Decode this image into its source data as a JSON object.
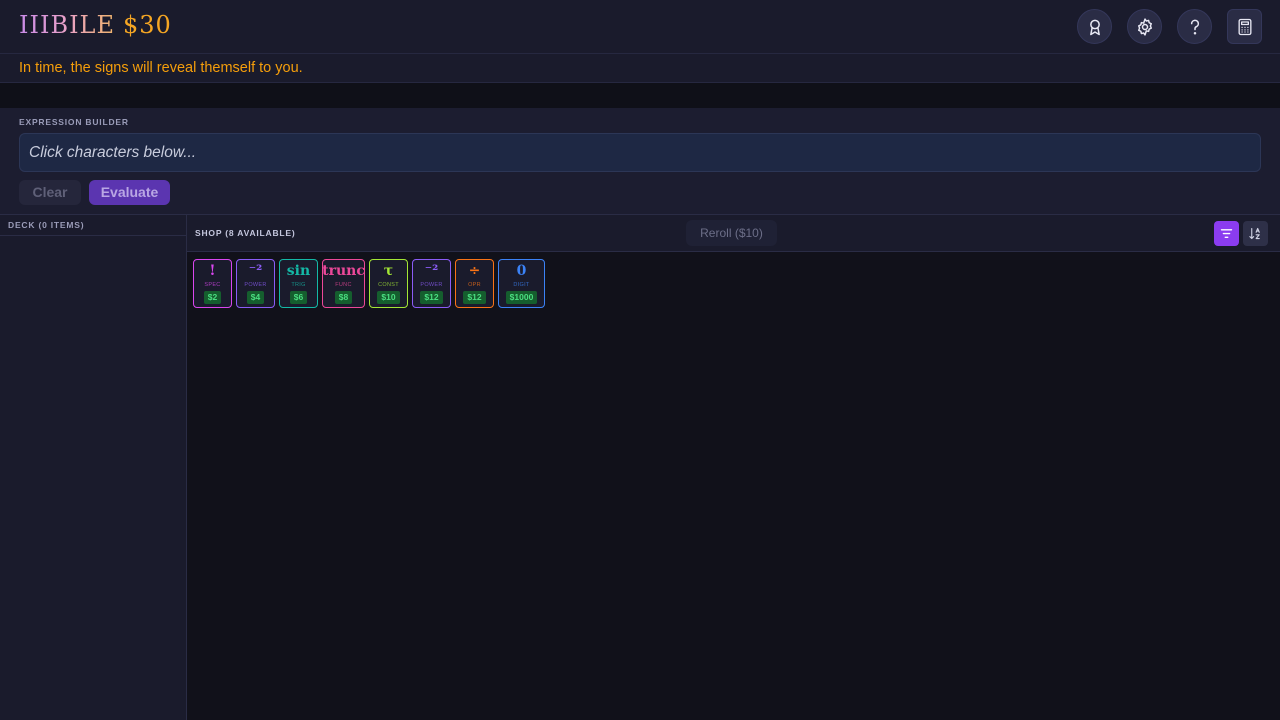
{
  "header": {
    "brand_name": "IIIBILE",
    "money": "$30",
    "buttons": [
      {
        "icon": "award-icon"
      },
      {
        "icon": "gear-icon"
      },
      {
        "icon": "help-icon"
      },
      {
        "icon": "calculator-icon"
      }
    ]
  },
  "hint": "In time, the signs will reveal themself to you.",
  "builder": {
    "label": "EXPRESSION BUILDER",
    "placeholder": "Click characters below...",
    "clear_label": "Clear",
    "evaluate_label": "Evaluate"
  },
  "deck": {
    "title": "DECK (0 ITEMS)"
  },
  "shop": {
    "title": "SHOP (8 AVAILABLE)",
    "reroll_label": "Reroll ($10)",
    "cards": [
      {
        "symbol": "!",
        "category": "SPEC",
        "price": "$2",
        "color": "#d946ef"
      },
      {
        "symbol": "⁻²",
        "category": "POWER",
        "price": "$4",
        "color": "#8b5cf6"
      },
      {
        "symbol": "sin",
        "category": "TRIG",
        "price": "$6",
        "color": "#14b8a6"
      },
      {
        "symbol": "trunc",
        "category": "FUNC",
        "price": "$8",
        "color": "#ec4899"
      },
      {
        "symbol": "τ",
        "category": "CONST",
        "price": "$10",
        "color": "#a3e635"
      },
      {
        "symbol": "⁻²",
        "category": "POWER",
        "price": "$12",
        "color": "#8b5cf6"
      },
      {
        "symbol": "÷",
        "category": "OPR",
        "price": "$12",
        "color": "#f97316"
      },
      {
        "symbol": "0",
        "category": "DIGIT",
        "price": "$1000",
        "color": "#3b82f6"
      }
    ]
  }
}
